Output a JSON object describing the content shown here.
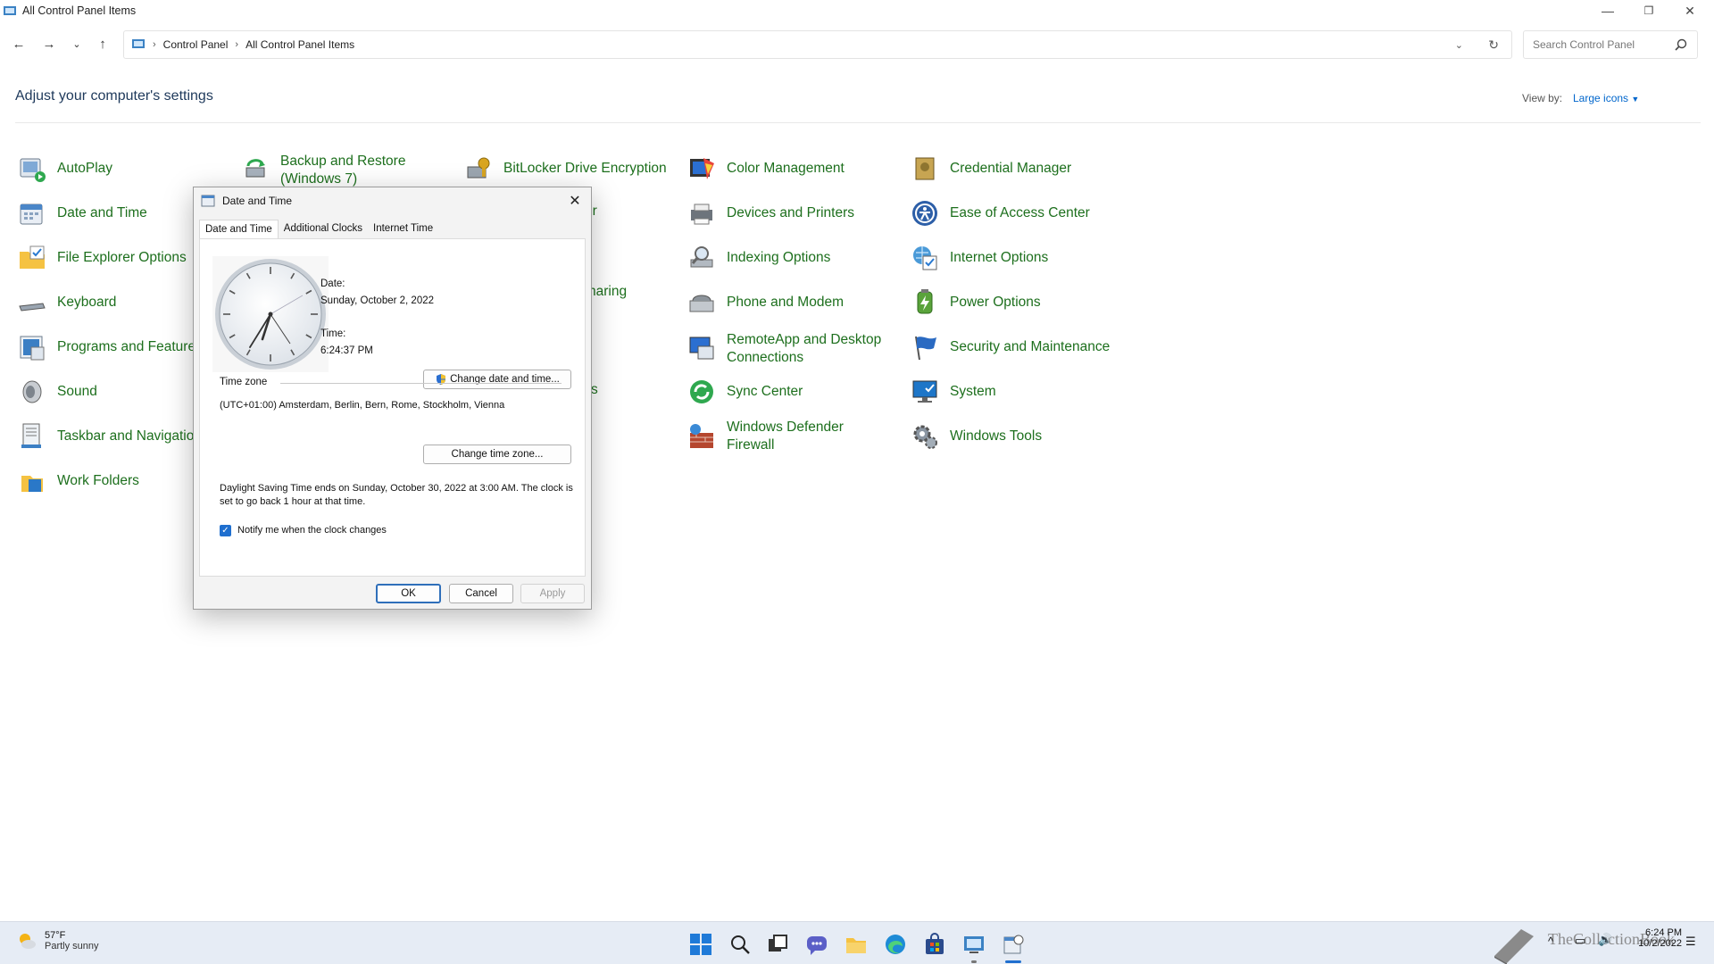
{
  "window": {
    "title": "All Control Panel Items",
    "minimize_icon": "minimize-icon",
    "restore_icon": "restore-icon",
    "close_icon": "close-icon"
  },
  "nav": {
    "breadcrumb": [
      "Control Panel",
      "All Control Panel Items"
    ],
    "search_placeholder": "Search Control Panel"
  },
  "header": {
    "title": "Adjust your computer's settings",
    "view_by_label": "View by:",
    "view_by_value": "Large icons"
  },
  "items": {
    "autoplay": "AutoPlay",
    "backup": "Backup and Restore (Windows 7)",
    "bitlocker": "BitLocker Drive Encryption",
    "color_mgmt": "Color Management",
    "credential": "Credential Manager",
    "date_time": "Date and Time",
    "partial_er": "er",
    "devices": "Devices and Printers",
    "ease": "Ease of Access Center",
    "file_explorer": "File Explorer Options",
    "indexing": "Indexing Options",
    "internet_options": "Internet Options",
    "keyboard": "Keyboard",
    "partial_sharing": "haring",
    "phone_modem": "Phone and Modem",
    "power": "Power Options",
    "programs": "Programs and Feature",
    "remoteapp": "RemoteApp and Desktop Connections",
    "security": "Security and Maintenance",
    "sound": "Sound",
    "partial_s": "s",
    "sync": "Sync Center",
    "system": "System",
    "taskbar_nav": "Taskbar and Navigatio",
    "defender": "Windows Defender Firewall",
    "tools": "Windows Tools",
    "work_folders": "Work Folders"
  },
  "dialog": {
    "title": "Date and Time",
    "tabs": [
      "Date and Time",
      "Additional Clocks",
      "Internet Time"
    ],
    "date_label": "Date:",
    "date_value": "Sunday, October 2, 2022",
    "time_label": "Time:",
    "time_value": "6:24:37 PM",
    "change_datetime": "Change date and time...",
    "timezone_label": "Time zone",
    "timezone_value": "(UTC+01:00) Amsterdam, Berlin, Bern, Rome, Stockholm, Vienna",
    "change_timezone": "Change time zone...",
    "dst_text": "Daylight Saving Time ends on Sunday, October 30, 2022 at 3:00 AM. The clock is set to go back 1 hour at that time.",
    "notify_label": "Notify me when the clock changes",
    "notify_checked": true,
    "ok": "OK",
    "cancel": "Cancel",
    "apply": "Apply"
  },
  "taskbar": {
    "temp": "57°F",
    "condition": "Partly sunny",
    "clock_time": "6:24 PM",
    "clock_date": "10/2/2022",
    "watermark": "TheCollectionBook"
  }
}
